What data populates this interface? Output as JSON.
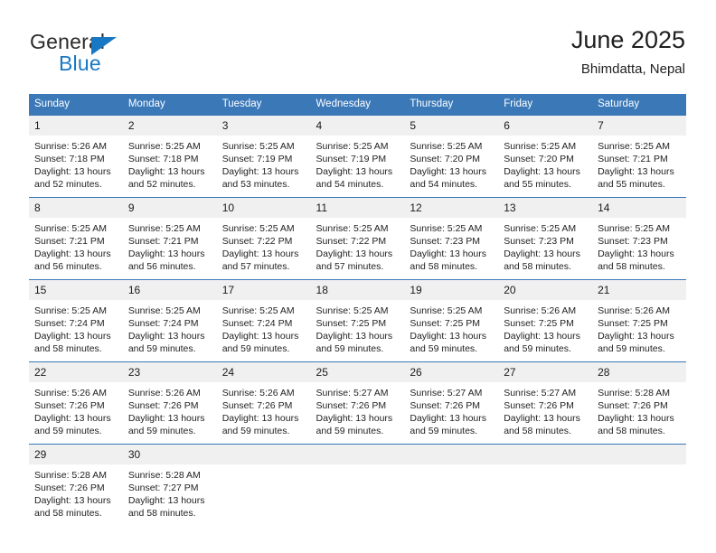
{
  "logo": {
    "word1": "General",
    "word2": "Blue",
    "triangle_color": "#1878c4",
    "icon": "triangle-icon"
  },
  "header": {
    "title": "June 2025",
    "subtitle": "Bhimdatta, Nepal"
  },
  "colors": {
    "header_blue": "#3a78b8",
    "daynum_background": "#f0f0f0",
    "brand_blue": "#1878c4"
  },
  "weekday_headers": [
    "Sunday",
    "Monday",
    "Tuesday",
    "Wednesday",
    "Thursday",
    "Friday",
    "Saturday"
  ],
  "labels": {
    "sunrise_prefix": "Sunrise:",
    "sunset_prefix": "Sunset:",
    "daylight_prefix": "Daylight:"
  },
  "weeks": [
    {
      "days": [
        {
          "date": "1",
          "sunrise": "Sunrise: 5:26 AM",
          "sunset": "Sunset: 7:18 PM",
          "daylight_line1": "Daylight: 13 hours",
          "daylight_line2": "and 52 minutes."
        },
        {
          "date": "2",
          "sunrise": "Sunrise: 5:25 AM",
          "sunset": "Sunset: 7:18 PM",
          "daylight_line1": "Daylight: 13 hours",
          "daylight_line2": "and 52 minutes."
        },
        {
          "date": "3",
          "sunrise": "Sunrise: 5:25 AM",
          "sunset": "Sunset: 7:19 PM",
          "daylight_line1": "Daylight: 13 hours",
          "daylight_line2": "and 53 minutes."
        },
        {
          "date": "4",
          "sunrise": "Sunrise: 5:25 AM",
          "sunset": "Sunset: 7:19 PM",
          "daylight_line1": "Daylight: 13 hours",
          "daylight_line2": "and 54 minutes."
        },
        {
          "date": "5",
          "sunrise": "Sunrise: 5:25 AM",
          "sunset": "Sunset: 7:20 PM",
          "daylight_line1": "Daylight: 13 hours",
          "daylight_line2": "and 54 minutes."
        },
        {
          "date": "6",
          "sunrise": "Sunrise: 5:25 AM",
          "sunset": "Sunset: 7:20 PM",
          "daylight_line1": "Daylight: 13 hours",
          "daylight_line2": "and 55 minutes."
        },
        {
          "date": "7",
          "sunrise": "Sunrise: 5:25 AM",
          "sunset": "Sunset: 7:21 PM",
          "daylight_line1": "Daylight: 13 hours",
          "daylight_line2": "and 55 minutes."
        }
      ]
    },
    {
      "days": [
        {
          "date": "8",
          "sunrise": "Sunrise: 5:25 AM",
          "sunset": "Sunset: 7:21 PM",
          "daylight_line1": "Daylight: 13 hours",
          "daylight_line2": "and 56 minutes."
        },
        {
          "date": "9",
          "sunrise": "Sunrise: 5:25 AM",
          "sunset": "Sunset: 7:21 PM",
          "daylight_line1": "Daylight: 13 hours",
          "daylight_line2": "and 56 minutes."
        },
        {
          "date": "10",
          "sunrise": "Sunrise: 5:25 AM",
          "sunset": "Sunset: 7:22 PM",
          "daylight_line1": "Daylight: 13 hours",
          "daylight_line2": "and 57 minutes."
        },
        {
          "date": "11",
          "sunrise": "Sunrise: 5:25 AM",
          "sunset": "Sunset: 7:22 PM",
          "daylight_line1": "Daylight: 13 hours",
          "daylight_line2": "and 57 minutes."
        },
        {
          "date": "12",
          "sunrise": "Sunrise: 5:25 AM",
          "sunset": "Sunset: 7:23 PM",
          "daylight_line1": "Daylight: 13 hours",
          "daylight_line2": "and 58 minutes."
        },
        {
          "date": "13",
          "sunrise": "Sunrise: 5:25 AM",
          "sunset": "Sunset: 7:23 PM",
          "daylight_line1": "Daylight: 13 hours",
          "daylight_line2": "and 58 minutes."
        },
        {
          "date": "14",
          "sunrise": "Sunrise: 5:25 AM",
          "sunset": "Sunset: 7:23 PM",
          "daylight_line1": "Daylight: 13 hours",
          "daylight_line2": "and 58 minutes."
        }
      ]
    },
    {
      "days": [
        {
          "date": "15",
          "sunrise": "Sunrise: 5:25 AM",
          "sunset": "Sunset: 7:24 PM",
          "daylight_line1": "Daylight: 13 hours",
          "daylight_line2": "and 58 minutes."
        },
        {
          "date": "16",
          "sunrise": "Sunrise: 5:25 AM",
          "sunset": "Sunset: 7:24 PM",
          "daylight_line1": "Daylight: 13 hours",
          "daylight_line2": "and 59 minutes."
        },
        {
          "date": "17",
          "sunrise": "Sunrise: 5:25 AM",
          "sunset": "Sunset: 7:24 PM",
          "daylight_line1": "Daylight: 13 hours",
          "daylight_line2": "and 59 minutes."
        },
        {
          "date": "18",
          "sunrise": "Sunrise: 5:25 AM",
          "sunset": "Sunset: 7:25 PM",
          "daylight_line1": "Daylight: 13 hours",
          "daylight_line2": "and 59 minutes."
        },
        {
          "date": "19",
          "sunrise": "Sunrise: 5:25 AM",
          "sunset": "Sunset: 7:25 PM",
          "daylight_line1": "Daylight: 13 hours",
          "daylight_line2": "and 59 minutes."
        },
        {
          "date": "20",
          "sunrise": "Sunrise: 5:26 AM",
          "sunset": "Sunset: 7:25 PM",
          "daylight_line1": "Daylight: 13 hours",
          "daylight_line2": "and 59 minutes."
        },
        {
          "date": "21",
          "sunrise": "Sunrise: 5:26 AM",
          "sunset": "Sunset: 7:25 PM",
          "daylight_line1": "Daylight: 13 hours",
          "daylight_line2": "and 59 minutes."
        }
      ]
    },
    {
      "days": [
        {
          "date": "22",
          "sunrise": "Sunrise: 5:26 AM",
          "sunset": "Sunset: 7:26 PM",
          "daylight_line1": "Daylight: 13 hours",
          "daylight_line2": "and 59 minutes."
        },
        {
          "date": "23",
          "sunrise": "Sunrise: 5:26 AM",
          "sunset": "Sunset: 7:26 PM",
          "daylight_line1": "Daylight: 13 hours",
          "daylight_line2": "and 59 minutes."
        },
        {
          "date": "24",
          "sunrise": "Sunrise: 5:26 AM",
          "sunset": "Sunset: 7:26 PM",
          "daylight_line1": "Daylight: 13 hours",
          "daylight_line2": "and 59 minutes."
        },
        {
          "date": "25",
          "sunrise": "Sunrise: 5:27 AM",
          "sunset": "Sunset: 7:26 PM",
          "daylight_line1": "Daylight: 13 hours",
          "daylight_line2": "and 59 minutes."
        },
        {
          "date": "26",
          "sunrise": "Sunrise: 5:27 AM",
          "sunset": "Sunset: 7:26 PM",
          "daylight_line1": "Daylight: 13 hours",
          "daylight_line2": "and 59 minutes."
        },
        {
          "date": "27",
          "sunrise": "Sunrise: 5:27 AM",
          "sunset": "Sunset: 7:26 PM",
          "daylight_line1": "Daylight: 13 hours",
          "daylight_line2": "and 58 minutes."
        },
        {
          "date": "28",
          "sunrise": "Sunrise: 5:28 AM",
          "sunset": "Sunset: 7:26 PM",
          "daylight_line1": "Daylight: 13 hours",
          "daylight_line2": "and 58 minutes."
        }
      ]
    },
    {
      "days": [
        {
          "date": "29",
          "sunrise": "Sunrise: 5:28 AM",
          "sunset": "Sunset: 7:26 PM",
          "daylight_line1": "Daylight: 13 hours",
          "daylight_line2": "and 58 minutes."
        },
        {
          "date": "30",
          "sunrise": "Sunrise: 5:28 AM",
          "sunset": "Sunset: 7:27 PM",
          "daylight_line1": "Daylight: 13 hours",
          "daylight_line2": "and 58 minutes."
        },
        {
          "date": "",
          "sunrise": "",
          "sunset": "",
          "daylight_line1": "",
          "daylight_line2": ""
        },
        {
          "date": "",
          "sunrise": "",
          "sunset": "",
          "daylight_line1": "",
          "daylight_line2": ""
        },
        {
          "date": "",
          "sunrise": "",
          "sunset": "",
          "daylight_line1": "",
          "daylight_line2": ""
        },
        {
          "date": "",
          "sunrise": "",
          "sunset": "",
          "daylight_line1": "",
          "daylight_line2": ""
        },
        {
          "date": "",
          "sunrise": "",
          "sunset": "",
          "daylight_line1": "",
          "daylight_line2": ""
        }
      ]
    }
  ]
}
